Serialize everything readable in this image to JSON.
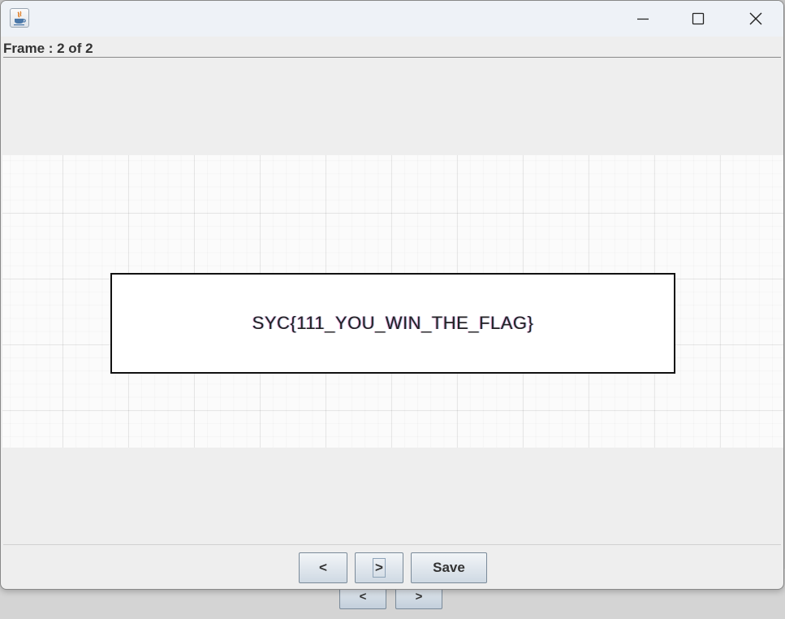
{
  "window": {
    "frame_label": "Frame : 2 of 2",
    "icon": "java-icon"
  },
  "titlebar": {
    "minimize_icon": "minimize-icon",
    "maximize_icon": "maximize-icon",
    "close_icon": "close-icon"
  },
  "canvas": {
    "flag_text": "SYC{111_YOU_WIN_THE_FLAG}"
  },
  "buttons": {
    "prev_label": "<",
    "next_label": ">",
    "save_label": "Save"
  },
  "background_window": {
    "prev_label": "<",
    "next_label": ">"
  }
}
